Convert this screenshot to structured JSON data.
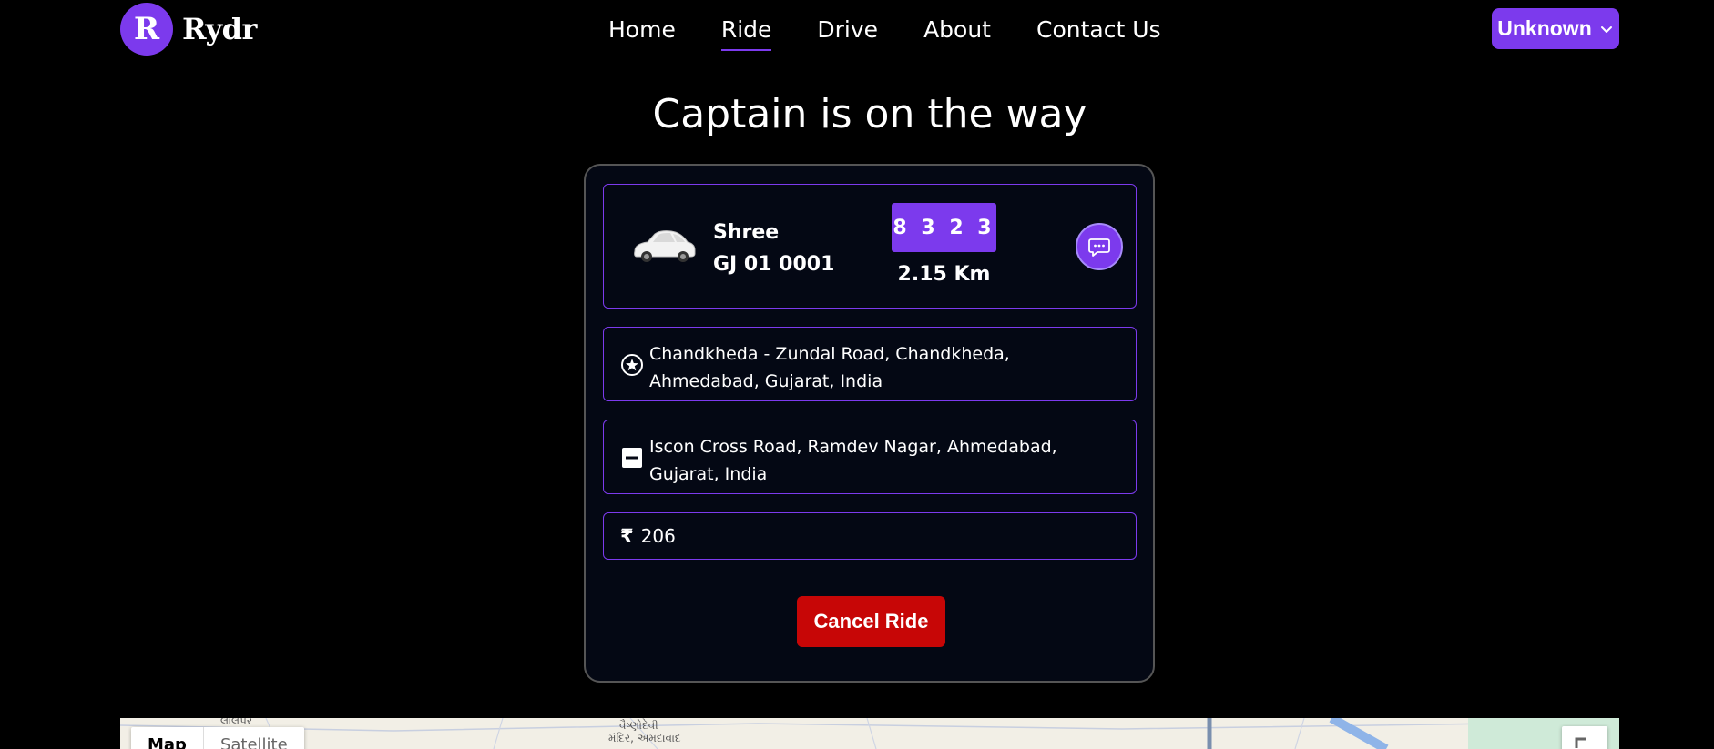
{
  "brand": {
    "logo_letter": "R",
    "name": "Rydr"
  },
  "nav": {
    "items": [
      {
        "label": "Home",
        "active": false
      },
      {
        "label": "Ride",
        "active": true
      },
      {
        "label": "Drive",
        "active": false
      },
      {
        "label": "About",
        "active": false
      },
      {
        "label": "Contact Us",
        "active": false
      }
    ]
  },
  "user_menu": {
    "label": "Unknown",
    "icon": "chevron-down-icon"
  },
  "page": {
    "title": "Captain is on the way"
  },
  "ride": {
    "driver_name": "Shree",
    "vehicle_plate": "GJ 01 0001",
    "otp": "8 3 2 3",
    "distance": "2.15 Km",
    "pickup": "Chandkheda - Zundal Road, Chandkheda, Ahmedabad, Gujarat, India",
    "drop": "Iscon Cross Road, Ramdev Nagar, Ahmedabad, Gujarat, India",
    "currency_symbol": "₹",
    "fare": "206",
    "cancel_label": "Cancel Ride"
  },
  "map": {
    "labels": [
      "લાલપર",
      "વૈષ્ણોદેવી",
      "મંદિર, અમદાવાદ"
    ],
    "view_options": [
      "Map",
      "Satellite"
    ],
    "selected_view": "Map"
  },
  "colors": {
    "accent": "#7c3aed",
    "danger": "#c70606",
    "card_bg": "#040814"
  }
}
